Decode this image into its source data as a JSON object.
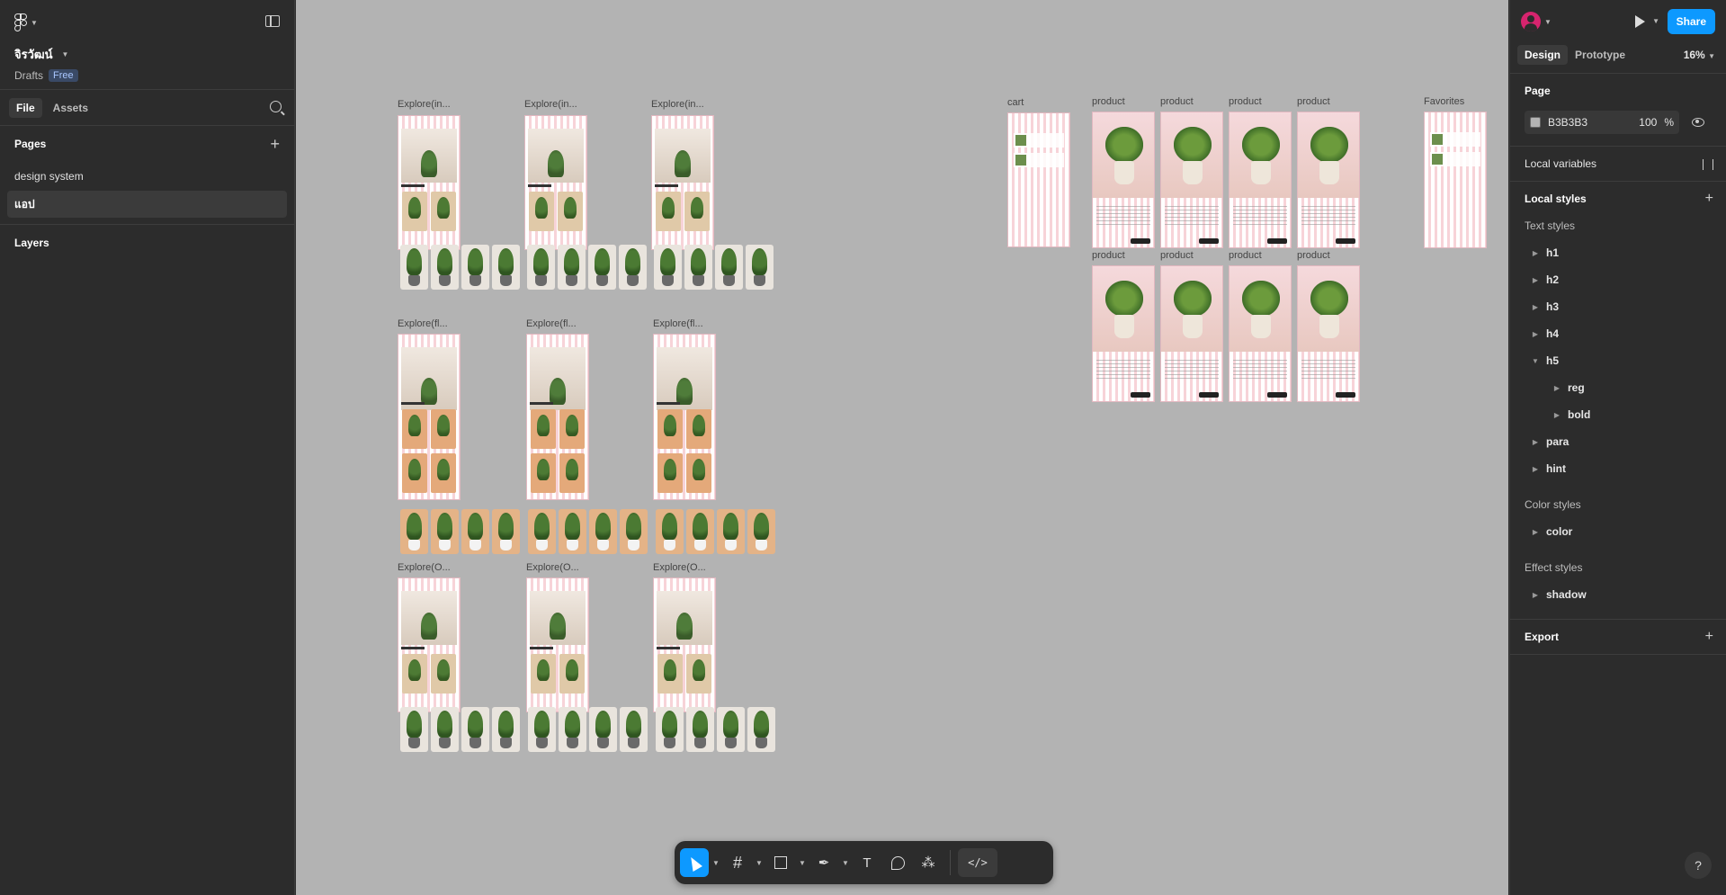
{
  "file": {
    "name": "จิรวัฒน์",
    "location": "Drafts",
    "plan_badge": "Free"
  },
  "left_tabs": {
    "file": "File",
    "assets": "Assets"
  },
  "pages": {
    "title": "Pages",
    "items": [
      "design system",
      "แอป"
    ]
  },
  "layers": {
    "title": "Layers"
  },
  "canvas": {
    "background": "#b3b3b3",
    "frame_labels": {
      "explore_in": [
        "Explore(in...",
        "Explore(in...",
        "Explore(in..."
      ],
      "explore_fl": [
        "Explore(fl...",
        "Explore(fl...",
        "Explore(fl..."
      ],
      "explore_o": [
        "Explore(O...",
        "Explore(O...",
        "Explore(O..."
      ],
      "cart": "cart",
      "products": [
        "product",
        "product",
        "product",
        "product",
        "product",
        "product",
        "product",
        "product"
      ],
      "favorites": "Favorites"
    }
  },
  "toolbar": {
    "tools": [
      "move-tool",
      "frame-tool",
      "shape-tool",
      "pen-tool",
      "text-tool",
      "comment-tool",
      "actions-tool",
      "dev-mode-toggle"
    ],
    "text_glyph": "T",
    "code_glyph": "</>"
  },
  "right_panel": {
    "share_label": "Share",
    "tabs": {
      "design": "Design",
      "prototype": "Prototype"
    },
    "zoom": "16%",
    "page": {
      "title": "Page",
      "color_hex": "B3B3B3",
      "opacity": "100",
      "percent": "%"
    },
    "local_variables": "Local variables",
    "local_styles": {
      "title": "Local styles",
      "text_styles_title": "Text styles",
      "text_styles": [
        "h1",
        "h2",
        "h3",
        "h4",
        "h5"
      ],
      "h5_children": [
        "reg",
        "bold"
      ],
      "text_styles_after": [
        "para",
        "hint"
      ],
      "color_styles_title": "Color styles",
      "color_styles": [
        "color"
      ],
      "effect_styles_title": "Effect styles",
      "effect_styles": [
        "shadow"
      ]
    },
    "export": "Export",
    "help": "?"
  },
  "colors": {
    "accent": "#0d99ff",
    "panel": "#2c2c2c",
    "canvas": "#b3b3b3"
  }
}
